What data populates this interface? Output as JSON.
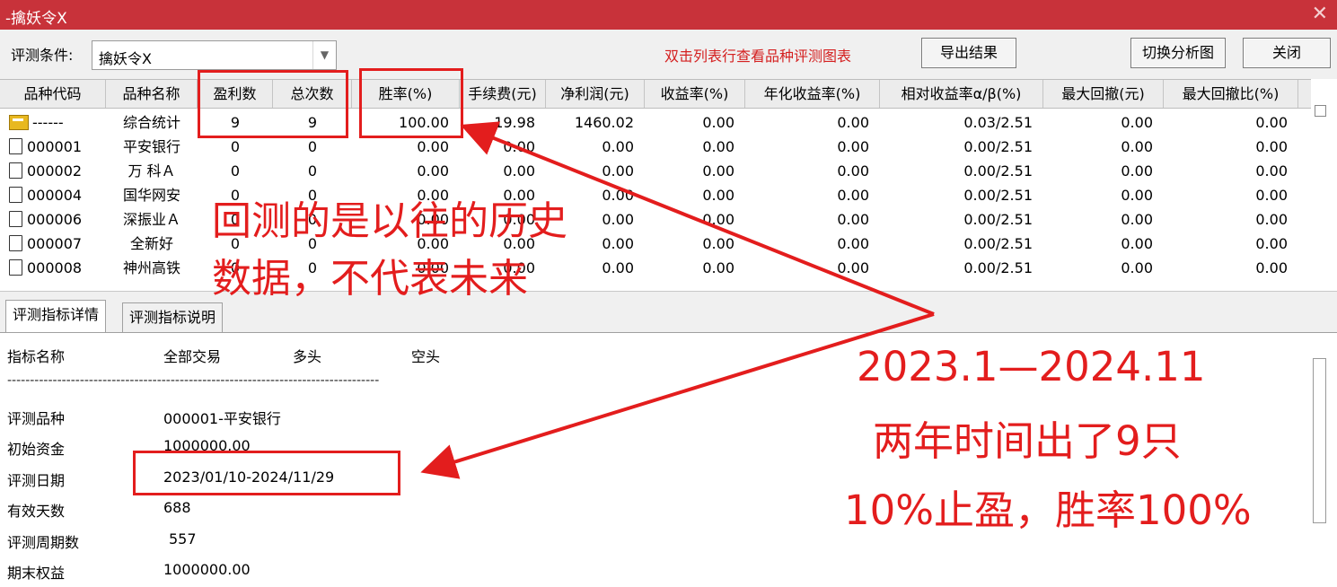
{
  "window": {
    "title": "-擒妖令X",
    "close_glyph": "✕"
  },
  "toolbar": {
    "condition_label": "评测条件:",
    "condition_value": "擒妖令X",
    "hint": "双击列表行查看品种评测图表",
    "export_label": "导出结果",
    "switch_label": "切换分析图",
    "close_label": "关闭"
  },
  "grid": {
    "columns": [
      "品种代码",
      "品种名称",
      "盈利数",
      "总次数",
      "胜率(%)",
      "手续费(元)",
      "净利润(元)",
      "收益率(%)",
      "年化收益率(%)",
      "相对收益率α/β(%)",
      "最大回撤(元)",
      "最大回撤比(%)"
    ],
    "rows": [
      [
        "------",
        "综合统计",
        "9",
        "9",
        "100.00",
        "19.98",
        "1460.02",
        "0.00",
        "0.00",
        "0.03/2.51",
        "0.00",
        "0.00"
      ],
      [
        "000001",
        "平安银行",
        "0",
        "0",
        "0.00",
        "0.00",
        "0.00",
        "0.00",
        "0.00",
        "0.00/2.51",
        "0.00",
        "0.00"
      ],
      [
        "000002",
        "万 科Ａ",
        "0",
        "0",
        "0.00",
        "0.00",
        "0.00",
        "0.00",
        "0.00",
        "0.00/2.51",
        "0.00",
        "0.00"
      ],
      [
        "000004",
        "国华网安",
        "0",
        "0",
        "0.00",
        "0.00",
        "0.00",
        "0.00",
        "0.00",
        "0.00/2.51",
        "0.00",
        "0.00"
      ],
      [
        "000006",
        "深振业Ａ",
        "0",
        "0",
        "0.00",
        "0.00",
        "0.00",
        "0.00",
        "0.00",
        "0.00/2.51",
        "0.00",
        "0.00"
      ],
      [
        "000007",
        "全新好",
        "0",
        "0",
        "0.00",
        "0.00",
        "0.00",
        "0.00",
        "0.00",
        "0.00/2.51",
        "0.00",
        "0.00"
      ],
      [
        "000008",
        "神州高铁",
        "0",
        "0",
        "0.00",
        "0.00",
        "0.00",
        "0.00",
        "0.00",
        "0.00/2.51",
        "0.00",
        "0.00"
      ]
    ]
  },
  "tabs": [
    "评测指标详情",
    "评测指标说明"
  ],
  "detail": {
    "headers": [
      "指标名称",
      "全部交易",
      "多头",
      "空头"
    ],
    "separator": "----------------------------------------------------------------------------------",
    "items": [
      {
        "label": "评测品种",
        "value": "000001-平安银行"
      },
      {
        "label": "初始资金",
        "value": "1000000.00"
      },
      {
        "label": "评测日期",
        "value": "2023/01/10-2024/11/29"
      },
      {
        "label": "有效天数",
        "value": "688"
      },
      {
        "label": "评测周期数",
        "value": "557"
      },
      {
        "label": "期末权益",
        "value": "1000000.00"
      }
    ]
  },
  "annotations": {
    "overlay_line1": "回测的是以往的历史",
    "overlay_line2": "数据，不代表未来",
    "note_line1": "2023.1—2024.11",
    "note_line2": "两年时间出了9只",
    "note_line3": "10%止盈，胜率100%",
    "color": "#e31d1d"
  }
}
